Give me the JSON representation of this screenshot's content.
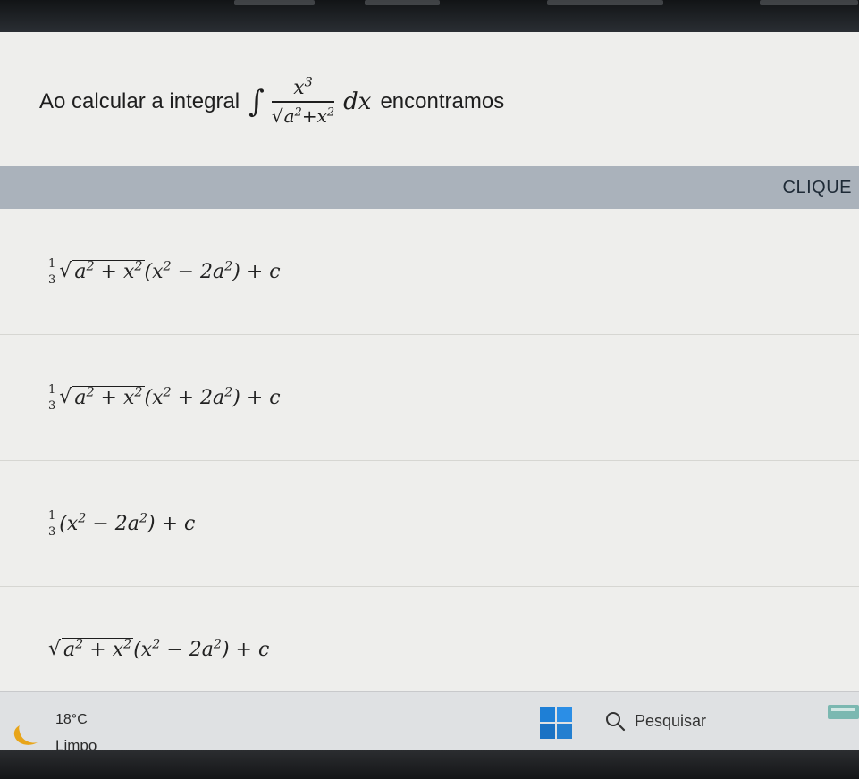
{
  "question": {
    "prefix": "Ao calcular a integral",
    "integral_sign": "∫",
    "numerator_base": "x",
    "numerator_exp": "3",
    "sqrt_sign": "√",
    "den_base1": "a",
    "den_exp1": "2",
    "den_plus": "+",
    "den_base2": "x",
    "den_exp2": "2",
    "dx": "dx",
    "suffix": "encontramos"
  },
  "banner": {
    "label": "CLIQUE"
  },
  "options": [
    {
      "frac_num": "1",
      "frac_den": "3",
      "sqrt_sign": "√",
      "rad_a": "a",
      "rad_exp1": "2",
      "rad_plus": " + ",
      "rad_x": "x",
      "rad_exp2": "2",
      "p_open": "(x",
      "p_exp1": "2",
      "p_mid": " − 2a",
      "p_exp2": "2",
      "p_close": ") + c"
    },
    {
      "frac_num": "1",
      "frac_den": "3",
      "sqrt_sign": "√",
      "rad_a": "a",
      "rad_exp1": "2",
      "rad_plus": " + ",
      "rad_x": "x",
      "rad_exp2": "2",
      "p_open": "(x",
      "p_exp1": "2",
      "p_mid": " + 2a",
      "p_exp2": "2",
      "p_close": ") + c"
    },
    {
      "frac_num": "1",
      "frac_den": "3",
      "p_open": "(x",
      "p_exp1": "2",
      "p_mid": " − 2a",
      "p_exp2": "2",
      "p_close": ") + c"
    },
    {
      "sqrt_sign": "√",
      "rad_a": "a",
      "rad_exp1": "2",
      "rad_plus": " + ",
      "rad_x": "x",
      "rad_exp2": "2",
      "p_open": "(x",
      "p_exp1": "2",
      "p_mid": " − 2a",
      "p_exp2": "2",
      "p_close": ") + c"
    }
  ],
  "taskbar": {
    "temperature": "18°C",
    "condition": "Limpo",
    "search_placeholder": "Pesquisar",
    "weather_icon": "moon-icon",
    "start_icon": "windows-start-icon",
    "search_icon": "search-icon"
  },
  "colors": {
    "screen_bg": "#eeeeec",
    "banner_bg": "#aab2bb",
    "taskbar_bg": "#dfe1e3",
    "accent_blue": "#1e7fd6",
    "moon_yellow": "#e8a51a"
  }
}
